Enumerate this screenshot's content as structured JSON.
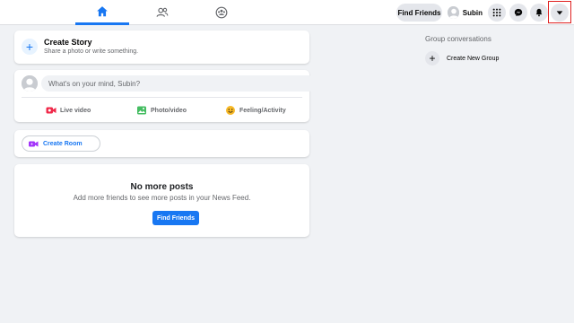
{
  "nav": {
    "tabs": [
      {
        "name": "home-icon",
        "active": true
      },
      {
        "name": "friends-icon",
        "active": false
      },
      {
        "name": "groups-icon",
        "active": false
      }
    ]
  },
  "header": {
    "find_friends_label": "Find Friends",
    "profile_name": "Subin"
  },
  "composer": {
    "create_story_title": "Create Story",
    "create_story_subtitle": "Share a photo or write something.",
    "post_placeholder": "What's on your mind, Subin?",
    "actions": [
      {
        "label": "Live video",
        "icon": "live-video-icon",
        "color": "#f02849"
      },
      {
        "label": "Photo/video",
        "icon": "photo-video-icon",
        "color": "#45bd62"
      },
      {
        "label": "Feeling/Activity",
        "icon": "feeling-activity-icon",
        "color": "#f7b928"
      }
    ]
  },
  "room": {
    "create_room_label": "Create Room"
  },
  "feed": {
    "empty_title": "No more posts",
    "empty_subtitle": "Add more friends to see more posts in your News Feed.",
    "find_friends_button": "Find Friends"
  },
  "sidebar": {
    "group_conversations_title": "Group conversations",
    "create_new_group_label": "Create New Group"
  },
  "colors": {
    "accent": "#1877f2",
    "background": "#f0f2f5",
    "highlight": "#e02020"
  }
}
